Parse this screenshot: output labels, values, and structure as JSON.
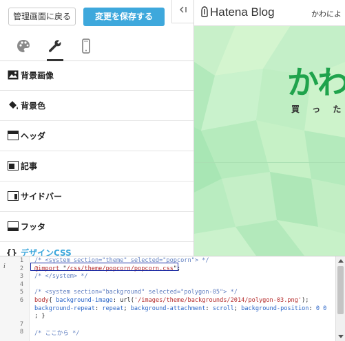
{
  "toolbar": {
    "back_label": "管理画面に戻る",
    "save_label": "変更を保存する",
    "collapse_label": "◂|"
  },
  "tabs": [
    {
      "name": "palette-icon"
    },
    {
      "name": "wrench-icon",
      "active": true
    },
    {
      "name": "mobile-icon"
    }
  ],
  "menu": {
    "items": [
      {
        "label": "背景画像",
        "icon": "image-icon"
      },
      {
        "label": "背景色",
        "icon": "paint-bucket-icon"
      },
      {
        "label": "ヘッダ",
        "icon": "header-layout-icon"
      },
      {
        "label": "記事",
        "icon": "article-layout-icon"
      },
      {
        "label": "サイドバー",
        "icon": "sidebar-layout-icon"
      },
      {
        "label": "フッタ",
        "icon": "footer-layout-icon"
      },
      {
        "label": "デザインCSS",
        "icon": "braces-icon"
      }
    ]
  },
  "preview": {
    "logo_text": "Hatena Blog",
    "user_text": "かわによ",
    "blog_title": "かわ",
    "blog_description": "買 っ た モ"
  },
  "editor": {
    "info_marker": "i",
    "lines": [
      {
        "num": "1",
        "parts": [
          {
            "t": "/* <system section=\"theme\" selected=\"popcorn\"> */",
            "c": "cm"
          }
        ]
      },
      {
        "num": "2",
        "parts": [
          {
            "t": "@import",
            "c": "kw"
          },
          {
            "t": " \"",
            "c": ""
          },
          {
            "t": "/css/theme/popcorn/popcorn.css",
            "c": "str"
          },
          {
            "t": "\";",
            "c": ""
          }
        ]
      },
      {
        "num": "3",
        "parts": [
          {
            "t": "/* </system> */",
            "c": "cm"
          }
        ]
      },
      {
        "num": "4",
        "parts": []
      },
      {
        "num": "5",
        "parts": [
          {
            "t": "/* <system section=\"background\" selected=\"polygon-05\"> */",
            "c": "cm"
          }
        ]
      },
      {
        "num": "6",
        "parts": [
          {
            "t": "body",
            "c": "kw"
          },
          {
            "t": "{ ",
            "c": ""
          },
          {
            "t": "background-image",
            "c": "prop"
          },
          {
            "t": ": url(",
            "c": ""
          },
          {
            "t": "'/images/theme/backgrounds/2014/polygon-03.png'",
            "c": "str"
          },
          {
            "t": ");",
            "c": ""
          }
        ]
      },
      {
        "num": "",
        "parts": [
          {
            "t": "    background-repeat",
            "c": "prop"
          },
          {
            "t": ": ",
            "c": ""
          },
          {
            "t": "repeat",
            "c": "val"
          },
          {
            "t": "; ",
            "c": ""
          },
          {
            "t": "background-attachment",
            "c": "prop"
          },
          {
            "t": ": ",
            "c": ""
          },
          {
            "t": "scroll",
            "c": "val"
          },
          {
            "t": "; ",
            "c": ""
          },
          {
            "t": "background-position",
            "c": "prop"
          },
          {
            "t": ": ",
            "c": ""
          },
          {
            "t": "0 0",
            "c": "val"
          }
        ]
      },
      {
        "num": "",
        "parts": [
          {
            "t": "    ; }",
            "c": ""
          }
        ]
      },
      {
        "num": "7",
        "parts": []
      },
      {
        "num": "8",
        "parts": [
          {
            "t": "/* ここから */",
            "c": "cm"
          }
        ]
      }
    ]
  },
  "colors": {
    "accent": "#3ea8dc",
    "title_green": "#1fa34c",
    "highlight_box": "#1b2ba5"
  }
}
